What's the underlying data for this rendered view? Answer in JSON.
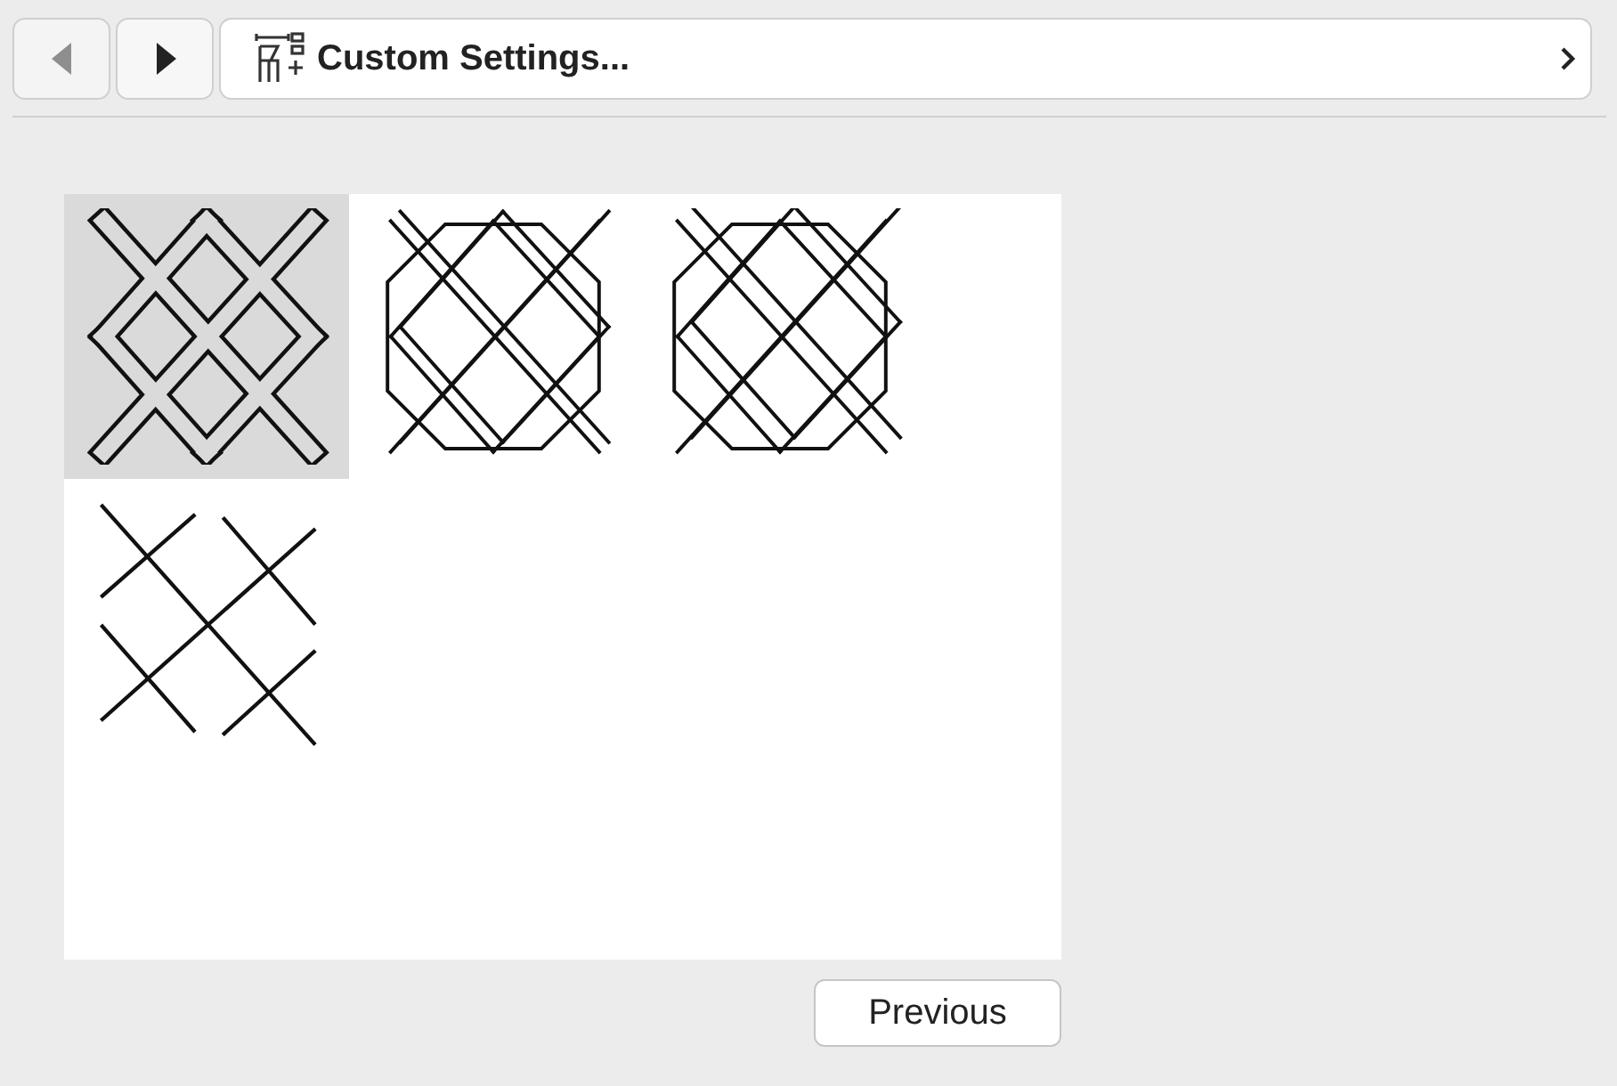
{
  "navigation": {
    "back": {
      "disabled": true
    },
    "forward": {
      "disabled": false
    }
  },
  "title": "Custom Settings...",
  "tiles": [
    {
      "kind": "thick-lattice",
      "selected": true
    },
    {
      "kind": "double-lattice",
      "selected": false
    },
    {
      "kind": "octagon-lattice",
      "selected": false
    },
    {
      "kind": "thin-lattice",
      "selected": false
    }
  ],
  "buttons": [
    "Previous"
  ]
}
